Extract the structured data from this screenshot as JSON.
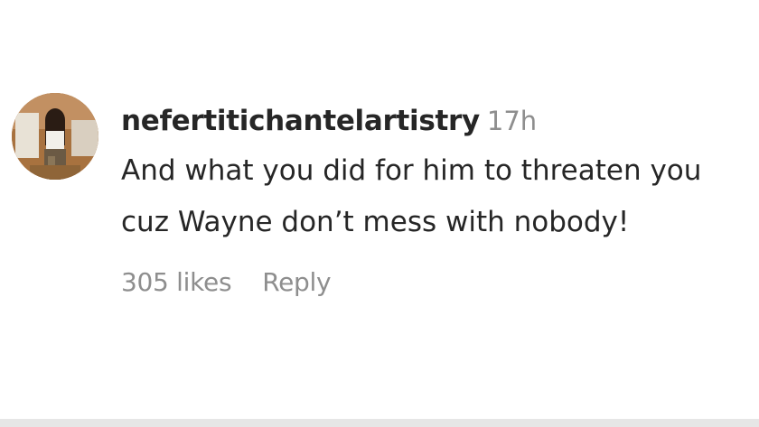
{
  "comment": {
    "username": "nefertitichantelartistry",
    "timestamp": "17h",
    "text": "And what you did for him to threaten you cuz Wayne don’t mess with nobody!",
    "likes": "305 likes",
    "reply_label": "Reply"
  },
  "colors": {
    "text_primary": "#262626",
    "text_secondary": "#8e8e8e",
    "background": "#ffffff"
  },
  "icons": {
    "avatar": "user-avatar-photo"
  }
}
